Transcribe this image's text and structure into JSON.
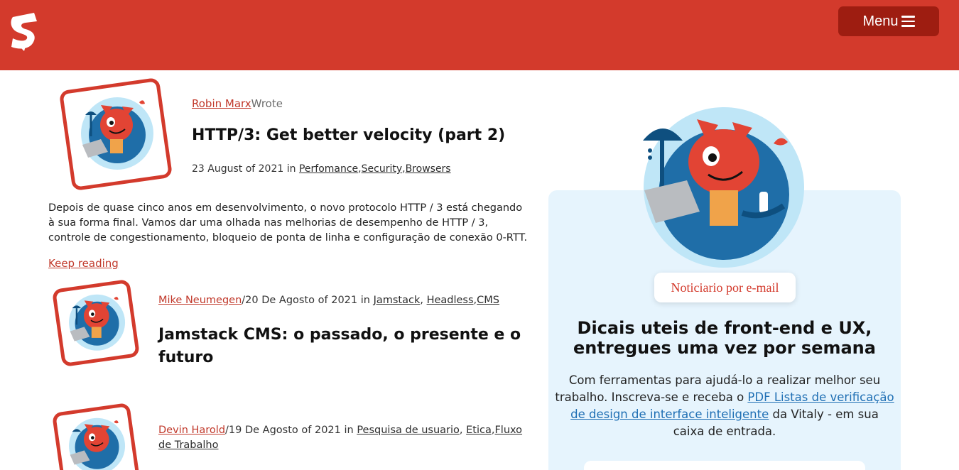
{
  "header": {
    "logo_letter": "S",
    "menu_label": "Menu",
    "brand_color": "#d33a2c",
    "menu_color": "#9e1d11"
  },
  "articles": [
    {
      "author": "Robin Marx",
      "wrote": "Wrote",
      "title": "HTTP/3: Get better velocity (part 2)",
      "date": "23 August of 2021",
      "in": "in",
      "tags": [
        "Perfomance",
        "Security",
        "Browsers"
      ],
      "excerpt": "Depois de quase cinco anos em desenvolvimento, o novo protocolo HTTP / 3 está chegando à sua forma final. Vamos dar uma olhada nas melhorias de desempenho de HTTP / 3, controle de congestionamento, bloqueio de ponta de linha e configuração de conexão 0-RTT.",
      "keep_reading": "Keep reading"
    },
    {
      "author": "Mike Neumegen",
      "date": "/20 De Agosto of 2021 in",
      "tags": [
        "Jamstack",
        "Headless",
        "CMS"
      ],
      "title": "Jamstack CMS: o passado, o presente e o futuro"
    },
    {
      "author": "Devin Harold",
      "date": "/19 De Agosto of 2021 in",
      "tags": [
        "Pesquisa de usuario",
        "Etica",
        "Fluxo de Trabalho"
      ]
    }
  ],
  "newsletter": {
    "badge": "Noticiario por e-mail",
    "title": "Dicais uteis de front-end e UX, entregues uma vez por semana",
    "text_before": "Com ferramentas para ajudá-lo a realizar melhor seu trabalho. Inscreva-se e receba o ",
    "link": "PDF Listas de verificação de design de interface inteligente",
    "text_after": " da Vitaly - em sua caixa de entrada.",
    "panel_color": "#e6f4fd",
    "link_color": "#1f6fb4"
  },
  "icons": [
    "logo-icon",
    "hamburger-icon",
    "author-avatar-icon",
    "newsletter-cat-illustration"
  ]
}
